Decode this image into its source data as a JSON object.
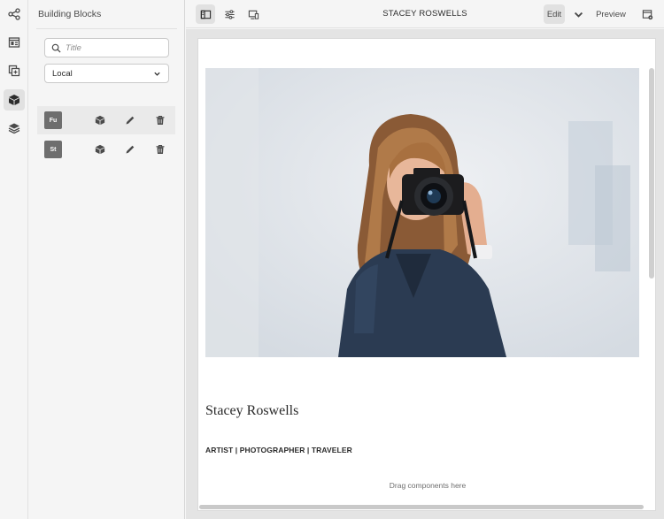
{
  "app": {
    "panel_title": "Building Blocks",
    "page_title": "STACEY ROSWELLS"
  },
  "rail": {
    "items": [
      {
        "icon": "share-icon",
        "active": false
      },
      {
        "icon": "page-template-icon",
        "active": false
      },
      {
        "icon": "add-component-icon",
        "active": false
      },
      {
        "icon": "building-block-icon",
        "active": true
      },
      {
        "icon": "layers-icon",
        "active": false
      }
    ]
  },
  "panel": {
    "search": {
      "placeholder": "Title",
      "value": ""
    },
    "filter": {
      "selected": "Local"
    },
    "blocks": [
      {
        "abbr": "Fu",
        "selected": true
      },
      {
        "abbr": "St",
        "selected": false
      }
    ]
  },
  "toolbar": {
    "edit_label": "Edit",
    "preview_label": "Preview"
  },
  "page": {
    "heading": "Stacey Roswells",
    "subheading": "ARTIST | PHOTOGRAPHER | TRAVELER",
    "drag_hint": "Drag components here"
  },
  "colors": {
    "panel_bg": "#f5f5f5",
    "active_bg": "#e1e1e1",
    "block_thumb": "#6e6e6e",
    "canvas_bg": "#e4e4e4"
  }
}
